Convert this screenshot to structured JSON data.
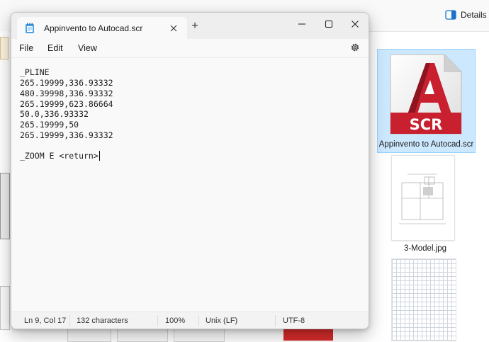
{
  "explorer": {
    "details_label": "Details",
    "files": [
      {
        "name": "Appinvento to Autocad.scr",
        "icon_text": "SCR",
        "selected": true
      },
      {
        "name": "3-Model.jpg"
      }
    ]
  },
  "notepad": {
    "tab_title": "Appinvento to Autocad.scr",
    "new_tab": "+",
    "menu": {
      "file": "File",
      "edit": "Edit",
      "view": "View"
    },
    "lines": [
      "_PLINE",
      "265.19999,336.93332",
      "480.39998,336.93332",
      "265.19999,623.86664",
      "50.0,336.93332",
      "265.19999,50",
      "265.19999,336.93332",
      "",
      "_ZOOM E <return>"
    ],
    "status": {
      "position": "Ln 9, Col 17",
      "characters": "132 characters",
      "zoom": "100%",
      "line_ending": "Unix (LF)",
      "encoding": "UTF-8"
    }
  },
  "colors": {
    "selection_bg": "#cce8ff",
    "autocad_red": "#c8202f"
  }
}
